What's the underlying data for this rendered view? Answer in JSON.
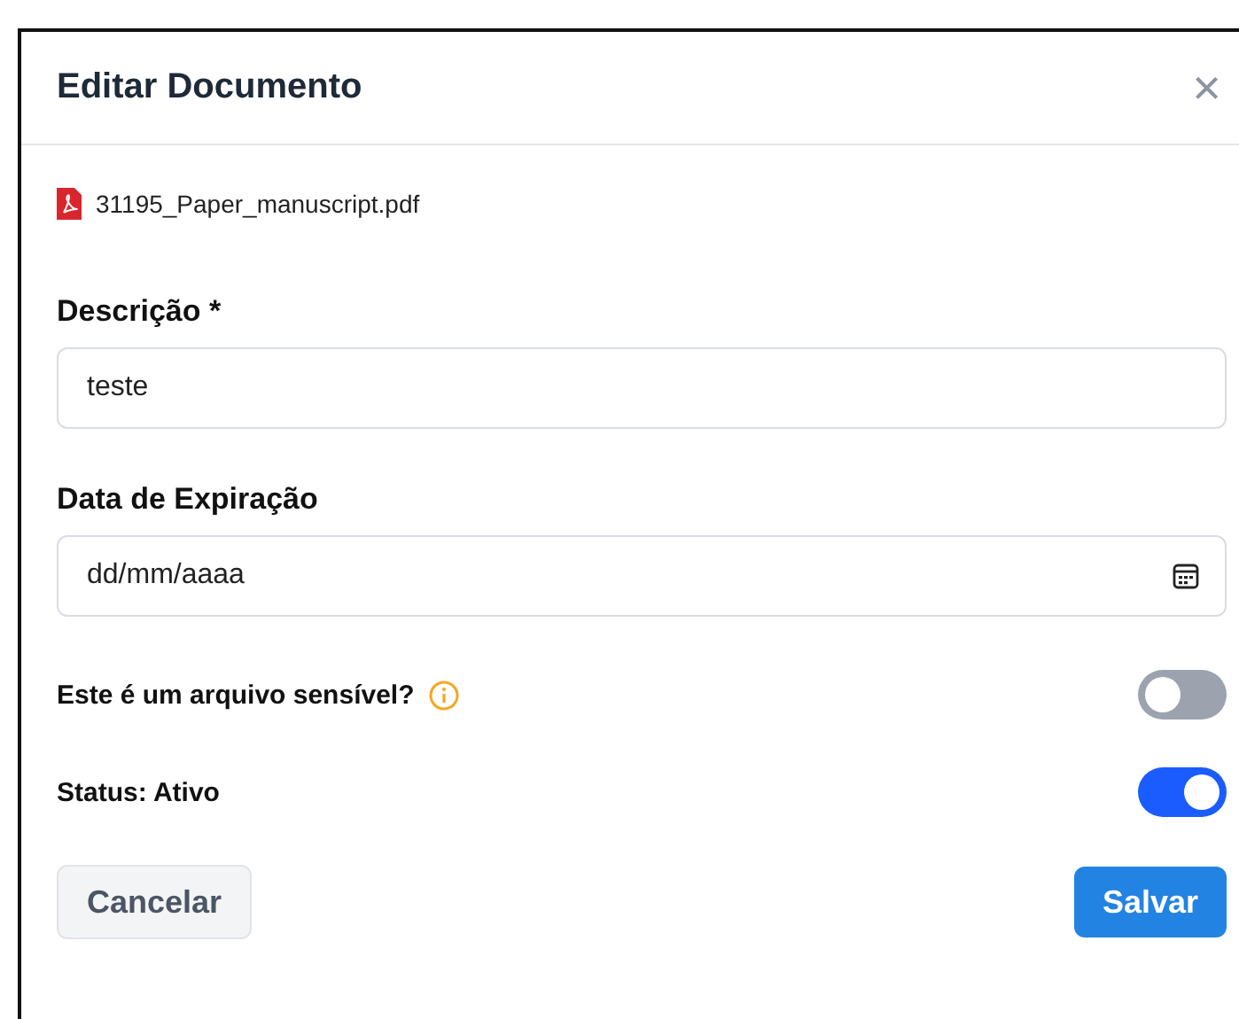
{
  "dialog": {
    "title": "Editar Documento",
    "close_label": "×"
  },
  "file": {
    "name": "31195_Paper_manuscript.pdf"
  },
  "fields": [
    {
      "kind": "text",
      "label": "Descrição *",
      "value": "teste"
    },
    {
      "kind": "date",
      "label": "Data de Expiração",
      "placeholder": "dd/mm/aaaa"
    }
  ],
  "toggles": [
    {
      "label": "Este é um arquivo sensível?",
      "info": true,
      "on": false
    },
    {
      "label": "Status: Ativo",
      "info": false,
      "on": true
    }
  ],
  "buttons": [
    {
      "kind": "secondary",
      "label": "Cancelar"
    },
    {
      "kind": "primary",
      "label": "Salvar"
    }
  ]
}
